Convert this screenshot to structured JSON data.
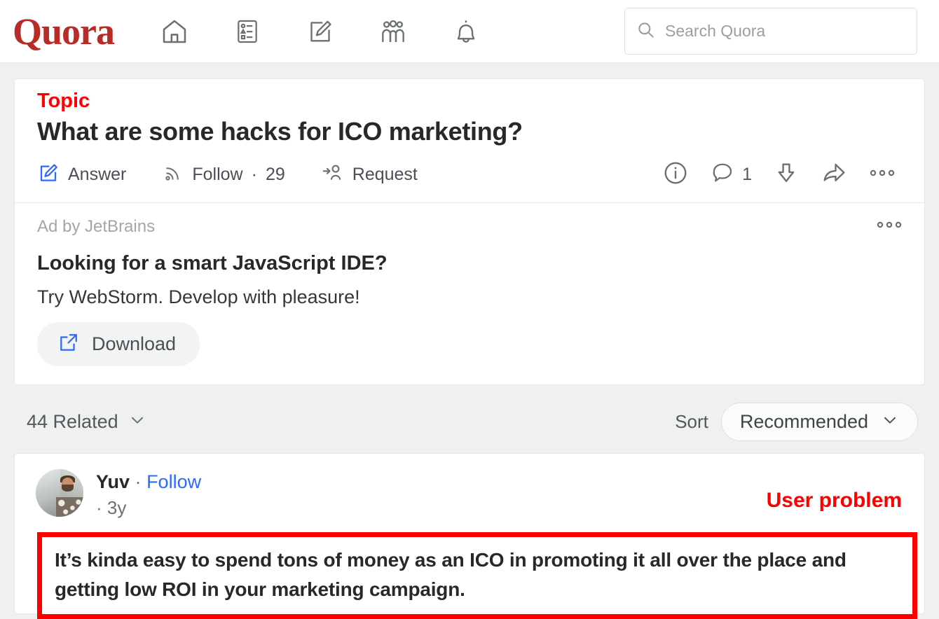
{
  "header": {
    "logo": "Quora",
    "nav": [
      {
        "name": "home-icon",
        "label": "Home"
      },
      {
        "name": "answer-list-icon",
        "label": "Answer"
      },
      {
        "name": "write-pencil-icon",
        "label": "Spaces"
      },
      {
        "name": "people-group-icon",
        "label": "Spaces"
      },
      {
        "name": "bell-icon",
        "label": "Notifications"
      }
    ],
    "search": {
      "placeholder": "Search Quora",
      "value": "",
      "icon": "search-icon"
    }
  },
  "annotations": {
    "topic": "Topic",
    "user_problem": "User problem",
    "color": "#ff0000",
    "box_color": "#fc0000"
  },
  "question": {
    "title": "What are some hacks for ICO marketing?",
    "actions": {
      "answer": "Answer",
      "follow": "Follow",
      "follow_separator": "·",
      "follow_count": "29",
      "request": "Request"
    },
    "right_actions": {
      "info_icon": "info-circle-icon",
      "comment_icon": "comment-icon",
      "comment_count": "1",
      "downvote_icon": "downvote-arrow-icon",
      "share_icon": "share-arrow-icon",
      "more_icon": "more-options-icon"
    }
  },
  "ad": {
    "label": "Ad by JetBrains",
    "title": "Looking for a smart JavaScript IDE?",
    "subtitle": "Try WebStorm. Develop with pleasure!",
    "cta": "Download",
    "cta_icon": "external-link-icon",
    "menu_icon": "ad-options-icon"
  },
  "meta_bar": {
    "related": "44 Related",
    "related_chevron": "chevron-down-icon",
    "sort_label": "Sort",
    "sort_value": "Recommended",
    "sort_chevron": "chevron-down-icon"
  },
  "answer": {
    "author_name": "Yuv",
    "author_separator": "·",
    "follow_label": "Follow",
    "timestamp": "· 3y",
    "avatar_icon": "user-avatar-photo",
    "text": "It’s kinda easy to spend tons of money as an ICO in promoting it all over the place and getting low ROI in your marketing campaign."
  },
  "colors": {
    "brand_red": "#b92b27",
    "link_blue": "#2e69ff",
    "annotation_red": "#ff0000",
    "page_bg": "#eff1f1",
    "card_bg": "#ffffff"
  }
}
